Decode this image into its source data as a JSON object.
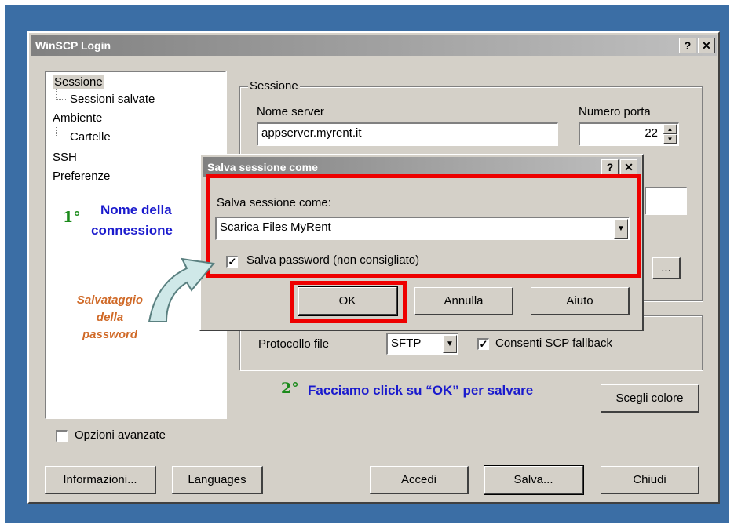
{
  "login": {
    "title": "WinSCP Login",
    "help_btn": "?",
    "close_btn": "✕",
    "tree": [
      "Sessione",
      "Sessioni salvate",
      "Ambiente",
      "Cartelle",
      "SSH",
      "Preferenze"
    ],
    "session_group": "Sessione",
    "server_label": "Nome server",
    "server_value": "appserver.myrent.it",
    "port_label": "Numero porta",
    "port_value": "22",
    "browse_btn": "...",
    "protocol_label": "Protocollo file",
    "protocol_value": "SFTP",
    "scp_fallback": "Consenti SCP fallback",
    "color_btn": "Scegli colore",
    "advanced": "Opzioni avanzate",
    "buttons": {
      "info": "Informazioni...",
      "languages": "Languages",
      "login": "Accedi",
      "save": "Salva...",
      "close": "Chiudi"
    }
  },
  "save_dialog": {
    "title": "Salva sessione come",
    "help_btn": "?",
    "close_btn": "✕",
    "name_label": "Salva sessione come:",
    "name_value": "Scarica Files MyRent",
    "save_password": "Salva password (non consigliato)",
    "ok": "OK",
    "cancel": "Annulla",
    "help": "Aiuto"
  },
  "annotations": {
    "step1_num": "1°",
    "step1_text_line1": "Nome della",
    "step1_text_line2": "connessione",
    "step2_num": "2°",
    "step2_text": "Facciamo click su “OK” per salvare",
    "password_note_line1": "Salvataggio",
    "password_note_line2": "della",
    "password_note_line3": "password"
  },
  "colors": {
    "desktop": "#3b6ea5",
    "highlight": "#ee0000",
    "anno_blue": "#1a1acd",
    "anno_green": "#1b8a1b",
    "anno_orange": "#d06a28"
  }
}
